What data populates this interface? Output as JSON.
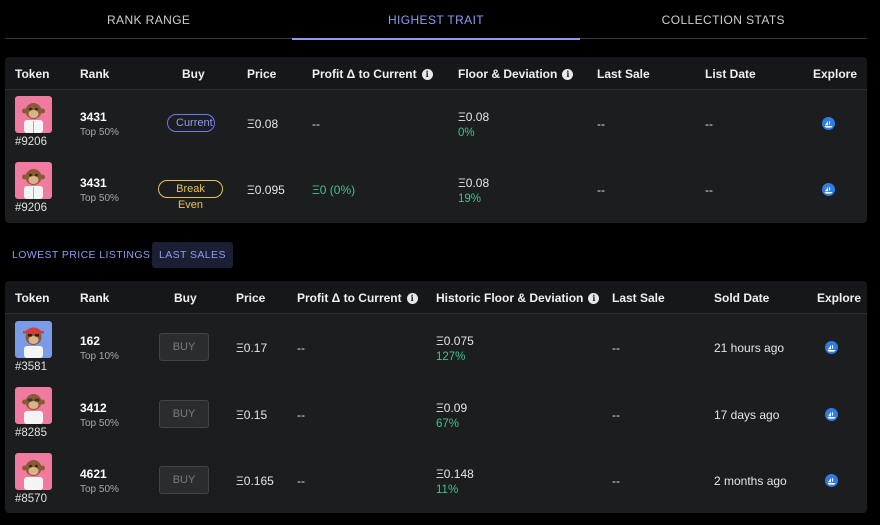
{
  "tabs": [
    {
      "label": "RANK RANGE",
      "active": false
    },
    {
      "label": "HIGHEST TRAIT",
      "active": true
    },
    {
      "label": "COLLECTION STATS",
      "active": false
    }
  ],
  "table1": {
    "headers": {
      "token": "Token",
      "rank": "Rank",
      "buy": "Buy",
      "price": "Price",
      "profit": "Profit Δ to Current",
      "floor": "Floor & Deviation",
      "last_sale": "Last Sale",
      "list_date": "List Date",
      "explore": "Explore"
    },
    "rows": [
      {
        "token": "#9206",
        "rank": "3431",
        "rank_tier": "Top 50%",
        "buy": "Current",
        "price": "Ξ0.08",
        "profit": "--",
        "floor": "Ξ0.08",
        "deviation": "0%",
        "last_sale": "--",
        "list_date": "--"
      },
      {
        "token": "#9206",
        "rank": "3431",
        "rank_tier": "Top 50%",
        "buy": "Break Even",
        "price": "Ξ0.095",
        "profit": "Ξ0 (0%)",
        "floor": "Ξ0.08",
        "deviation": "19%",
        "last_sale": "--",
        "list_date": "--"
      }
    ]
  },
  "subtabs": [
    {
      "label": "LOWEST PRICE LISTINGS",
      "active": false
    },
    {
      "label": "LAST SALES",
      "active": true
    }
  ],
  "table2": {
    "headers": {
      "token": "Token",
      "rank": "Rank",
      "buy": "Buy",
      "price": "Price",
      "profit": "Profit Δ to Current",
      "floor": "Historic Floor & Deviation",
      "last_sale": "Last Sale",
      "sold_date": "Sold Date",
      "explore": "Explore"
    },
    "rows": [
      {
        "token": "#3581",
        "rank": "162",
        "rank_tier": "Top 10%",
        "buy": "BUY",
        "price": "Ξ0.17",
        "profit": "--",
        "floor": "Ξ0.075",
        "deviation": "127%",
        "last_sale": "--",
        "sold_date": "21 hours ago"
      },
      {
        "token": "#8285",
        "rank": "3412",
        "rank_tier": "Top 50%",
        "buy": "BUY",
        "price": "Ξ0.15",
        "profit": "--",
        "floor": "Ξ0.09",
        "deviation": "67%",
        "last_sale": "--",
        "sold_date": "17 days ago"
      },
      {
        "token": "#8570",
        "rank": "4621",
        "rank_tier": "Top 50%",
        "buy": "BUY",
        "price": "Ξ0.165",
        "profit": "--",
        "floor": "Ξ0.148",
        "deviation": "11%",
        "last_sale": "--",
        "sold_date": "2 months ago"
      }
    ]
  },
  "colors": {
    "accent": "#8f9cf2",
    "positive": "#3ec48c",
    "break_even": "#e7c258",
    "explore": "#2f7de0",
    "avatar_pink": "#f07aa0",
    "avatar_blue": "#7a9ce8"
  },
  "icons": {
    "info": "info-icon",
    "explore": "opensea-icon",
    "avatar": "ape-avatar"
  }
}
